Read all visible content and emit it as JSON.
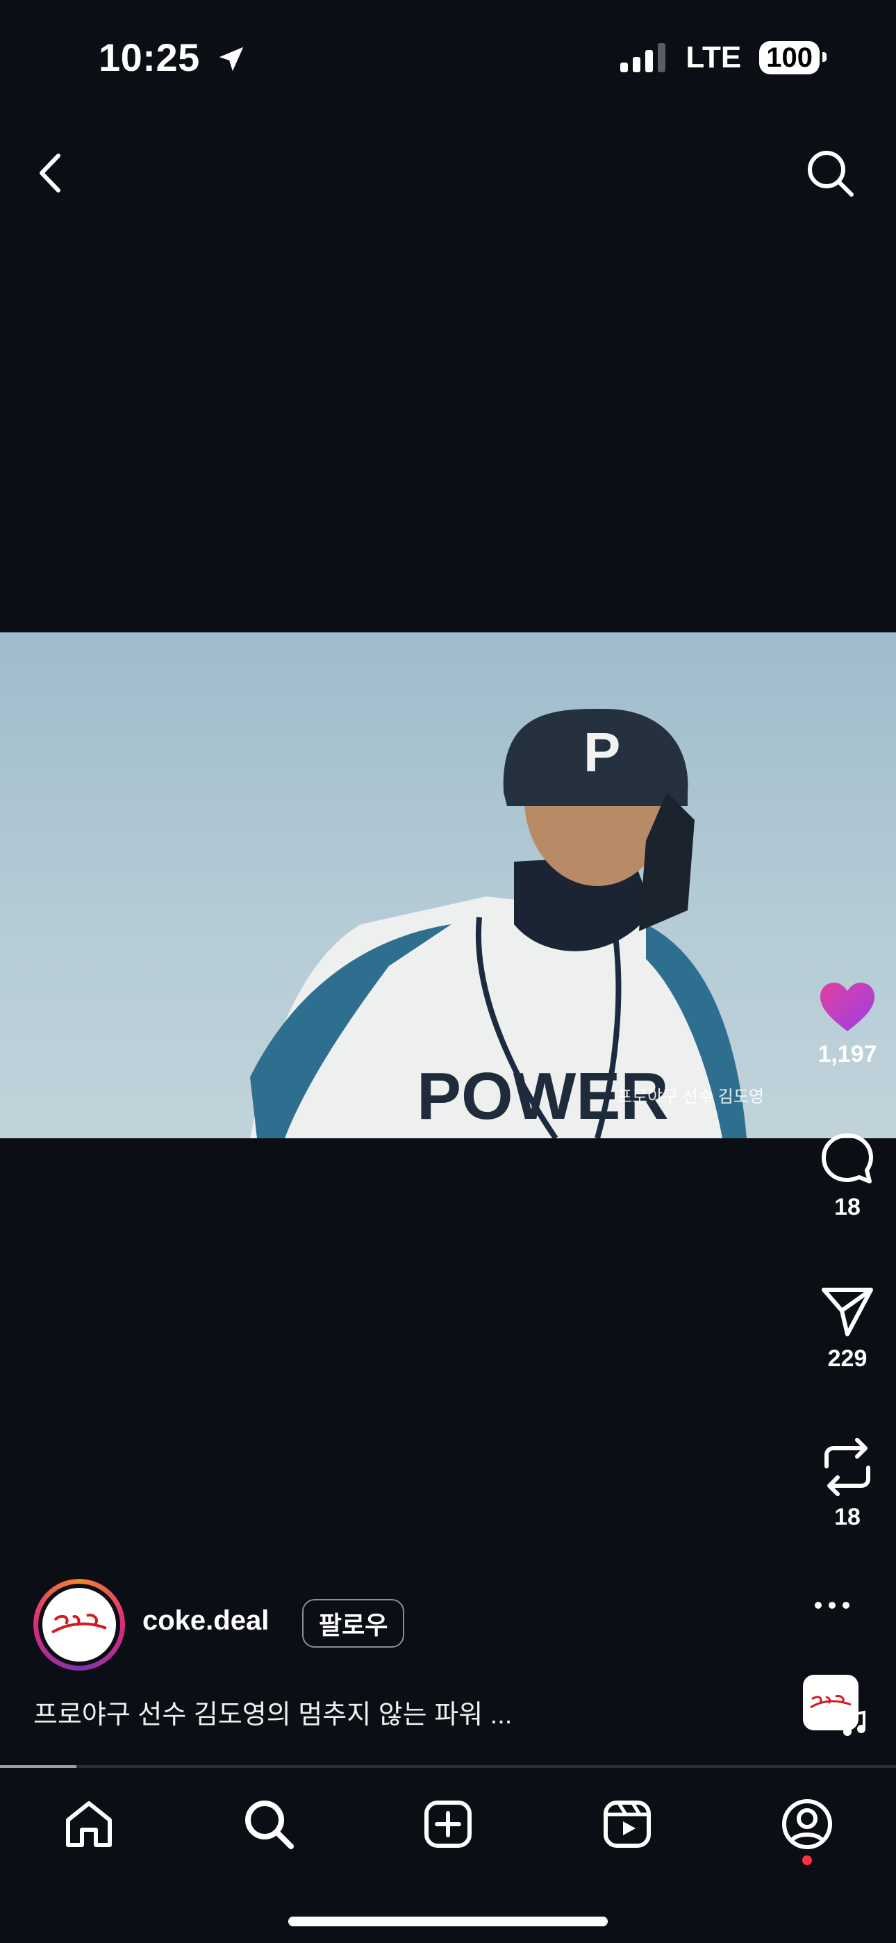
{
  "status_bar": {
    "time": "10:25",
    "network": "LTE",
    "battery": "100"
  },
  "header": {
    "back_icon": "chevron-left-icon",
    "search_icon": "search-icon"
  },
  "video": {
    "overlay_caption": "프로야구 선수 김도영"
  },
  "actions": {
    "likes": "1,197",
    "comments": "18",
    "shares": "229",
    "reposts": "18",
    "like_color": "#c53fd8"
  },
  "post": {
    "username": "coke.deal",
    "follow_label": "팔로우",
    "caption": "프로야구 선수 김도영의 멈추지 않는 파워 ...",
    "brand_logo": "Coca-Cola",
    "progress": 0.085
  },
  "tabs": [
    "home",
    "search",
    "create",
    "reels",
    "profile"
  ],
  "colors": {
    "background": "#0b0e14",
    "notification_dot": "#ff3040"
  }
}
